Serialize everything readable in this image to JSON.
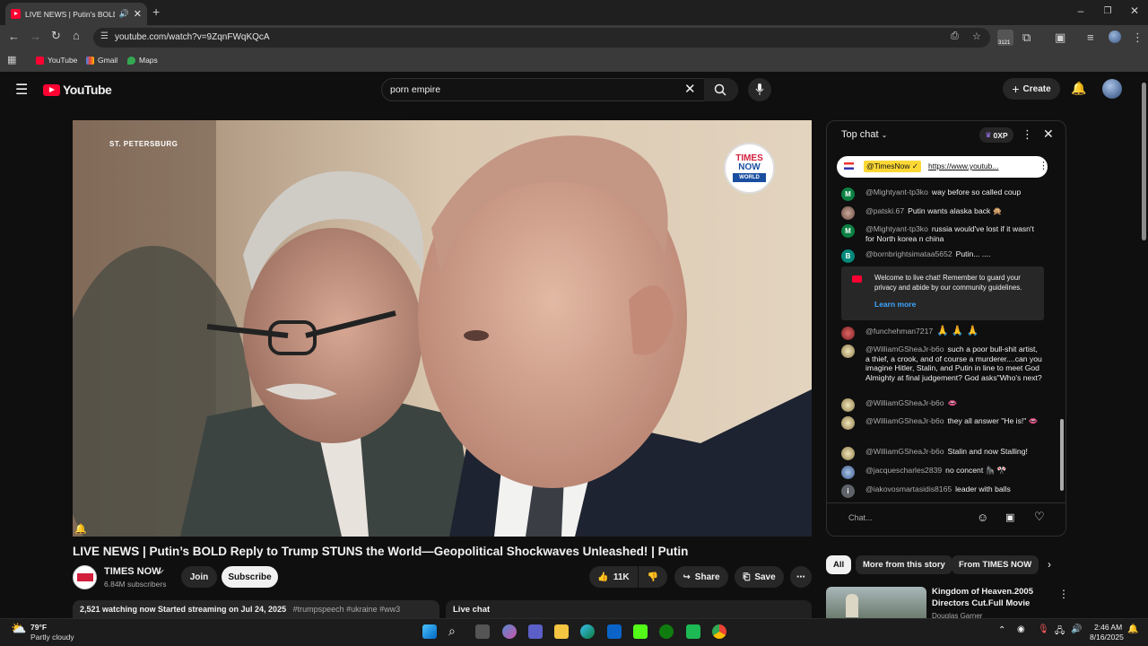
{
  "browser": {
    "tab_title": "LIVE NEWS | Putin's BOLD R",
    "url": "youtube.com/watch?v=9ZqnFWqKQcA",
    "bookmarks": [
      "YouTube",
      "Gmail",
      "Maps"
    ],
    "ext_badge": "3121"
  },
  "yt": {
    "logo": "YouTube",
    "search_value": "porn empire",
    "create_label": "Create"
  },
  "video": {
    "location_tag": "ST. PETERSBURG",
    "channel_logo_line1": "TIMES",
    "channel_logo_line2": "NOW",
    "channel_logo_line3": "WORLD",
    "title": "LIVE NEWS | Putin’s BOLD Reply to Trump STUNS the World—Geopolitical Shockwaves Unleashed! | Putin",
    "channel_name": "TIMES NOW",
    "subscribers": "6.84M subscribers",
    "join_label": "Join",
    "subscribe_label": "Subscribe",
    "likes": "11K",
    "share_label": "Share",
    "save_label": "Save",
    "desc_stats": "2,521 watching now  Started streaming on Jul 24, 2025",
    "desc_tags": "#trumpspeech #ukraine #ww3",
    "live_chat_label": "Live chat"
  },
  "chat": {
    "header": "Top chat",
    "xp": "0XP",
    "pinned_author": "@TimesNow ✓",
    "pinned_link": "https://www.youtub...",
    "messages": [
      {
        "author": "@Mightyant-tp3ko",
        "text": "way before so called coup",
        "initial": "M",
        "color": "#0b8043"
      },
      {
        "author": "@patski.67",
        "text": "Putin wants alaska back 🙊",
        "initial": "",
        "color": "#8a6a5a"
      },
      {
        "author": "@Mightyant-tp3ko",
        "text": "russia would've lost if it wasn't for North korea n china",
        "initial": "M",
        "color": "#0b8043"
      },
      {
        "author": "@bornbrightsimataa5652",
        "text": "Putin... ....",
        "initial": "B",
        "color": "#00897b"
      },
      {
        "author": "@funchehman7217",
        "text": "🙏 🙏 🙏",
        "initial": "",
        "color": "#9c2b2b"
      },
      {
        "author": "@WilliamGSheaJr-b6o",
        "text": "such a poor bull-shit artist, a thief, a crook, and of course a murderer....can you imagine Hitler, Stalin, and Putin in line to meet God Almighty at final judgement? God asks\"Who's next?",
        "initial": "",
        "color": "#c8b98a"
      },
      {
        "author": "@WilliamGSheaJr-b6o",
        "text": "👄",
        "initial": "",
        "color": "#c8b98a"
      },
      {
        "author": "@WilliamGSheaJr-b6o",
        "text": "they all answer \"He is!\" 👄",
        "initial": "",
        "color": "#c8b98a"
      },
      {
        "author": "@WilliamGSheaJr-b6o",
        "text": "Stalin and now Stalling!",
        "initial": "",
        "color": "#c8b98a"
      },
      {
        "author": "@jacquescharles2839",
        "text": "no concent 🦍 🎌",
        "initial": "",
        "color": "#6c8cb5"
      },
      {
        "author": "@iakovosmartasidis8165",
        "text": "leader with balls",
        "initial": "i",
        "color": "#5f6368"
      }
    ],
    "welcome_text": "Welcome to live chat! Remember to guard your privacy and abide by our community guidelines.",
    "learn_more": "Learn more",
    "input_placeholder": "Chat..."
  },
  "chips": [
    "All",
    "More from this story",
    "From TIMES NOW"
  ],
  "related": {
    "title": "Kingdom of Heaven.2005 Directors Cut.Full Movie",
    "channel": "Douglas Garner"
  },
  "taskbar": {
    "temp": "79°F",
    "weather": "Partly cloudy",
    "time": "2:46 AM",
    "date": "8/16/2025"
  },
  "colors": {
    "yt_red": "#ff0033",
    "bg": "#0f0f0f",
    "link": "#3ea6ff"
  }
}
